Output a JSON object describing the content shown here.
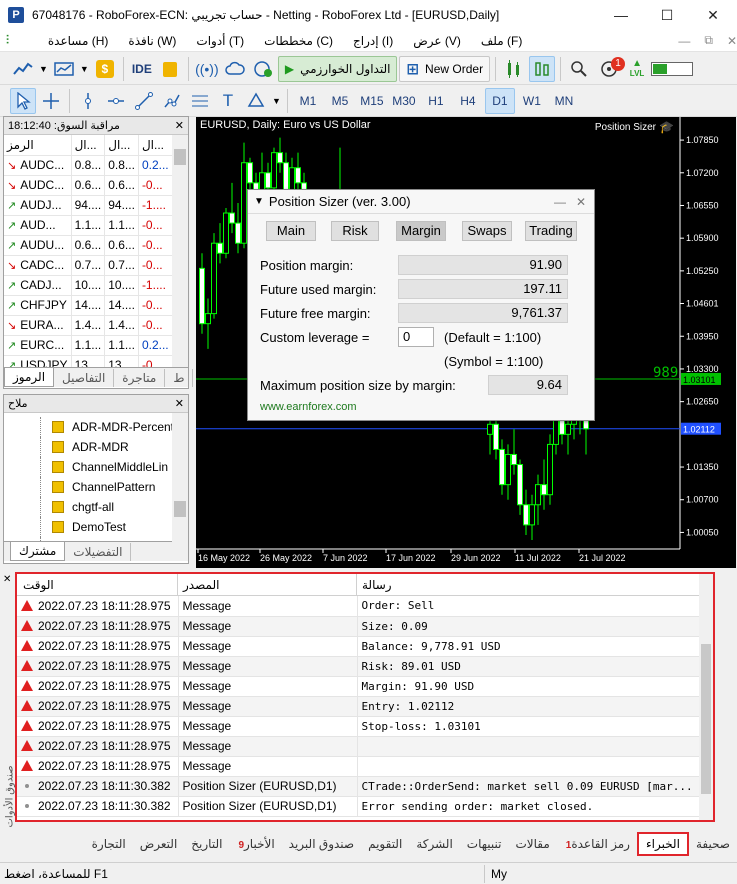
{
  "window": {
    "title": "67048176 - RoboForex-ECN: حساب تجريبي - Netting - RoboForex Ltd - [EURUSD,Daily]",
    "app_icon_letter": "P",
    "minimize": "—",
    "maximize": "☐",
    "close": "✕"
  },
  "menu": {
    "items": [
      "ملف (F)",
      "عرض (V)",
      "إدراج (I)",
      "مخططات (C)",
      "أدوات (T)",
      "نافذة (W)",
      "مساعدة (H)"
    ],
    "restore": "⧉",
    "close": "✕"
  },
  "toolbar1": {
    "ide": "IDE",
    "algo_trading": "التداول الخوارزمي",
    "new_order": "New Order",
    "notifications_count": "1",
    "lvl_label": "LVL"
  },
  "toolbar2": {
    "timeframes": [
      "M1",
      "M5",
      "M15",
      "M30",
      "H1",
      "H4",
      "D1",
      "W1",
      "MN"
    ],
    "selected_timeframe": "D1"
  },
  "market_watch": {
    "title": "مراقبة السوق: 18:12:40",
    "columns": [
      "الرمز",
      "ال...",
      "ال...",
      "ال..."
    ],
    "rows": [
      {
        "dir": "down",
        "symbol": "AUDC...",
        "bid": "0.8...",
        "ask": "0.8...",
        "chg": "0.2...",
        "chg_sign": "pos"
      },
      {
        "dir": "down",
        "symbol": "AUDC...",
        "bid": "0.6...",
        "ask": "0.6...",
        "chg": "-0...",
        "chg_sign": "neg"
      },
      {
        "dir": "up",
        "symbol": "AUDJ...",
        "bid": "94....",
        "ask": "94....",
        "chg": "-1....",
        "chg_sign": "neg"
      },
      {
        "dir": "up",
        "symbol": "AUD...",
        "bid": "1.1...",
        "ask": "1.1...",
        "chg": "-0...",
        "chg_sign": "neg"
      },
      {
        "dir": "up",
        "symbol": "AUDU...",
        "bid": "0.6...",
        "ask": "0.6...",
        "chg": "-0...",
        "chg_sign": "neg"
      },
      {
        "dir": "down",
        "symbol": "CADC...",
        "bid": "0.7...",
        "ask": "0.7...",
        "chg": "-0...",
        "chg_sign": "neg"
      },
      {
        "dir": "up",
        "symbol": "CADJ...",
        "bid": "10....",
        "ask": "10....",
        "chg": "-1....",
        "chg_sign": "neg"
      },
      {
        "dir": "up",
        "symbol": "CHFJPY",
        "bid": "14....",
        "ask": "14....",
        "chg": "-0...",
        "chg_sign": "neg"
      },
      {
        "dir": "down",
        "symbol": "EURA...",
        "bid": "1.4...",
        "ask": "1.4...",
        "chg": "-0...",
        "chg_sign": "neg"
      },
      {
        "dir": "up",
        "symbol": "EURC...",
        "bid": "1.1...",
        "ask": "1.1...",
        "chg": "0.2...",
        "chg_sign": "pos"
      },
      {
        "dir": "up",
        "symbol": "USDJPY",
        "bid": "13...",
        "ask": "13...",
        "chg": "-0...",
        "chg_sign": "neg"
      }
    ],
    "tabs": [
      "الرموز",
      "التفاصيل",
      "متاجرة",
      "ط"
    ]
  },
  "navigator": {
    "title": "ملاح",
    "items": [
      "ADR-MDR-Percent",
      "ADR-MDR",
      "ChannelMiddleLin",
      "ChannelPattern",
      "chgtf-all",
      "DemoTest",
      "DrawLines"
    ],
    "tabs": [
      "مشترك",
      "التفضيلات"
    ]
  },
  "chart": {
    "title": "EURUSD, Daily:  Euro vs US Dollar",
    "indicator_label": "Position Sizer",
    "price_labels": [
      "1.07850",
      "1.07200",
      "1.06550",
      "1.05900",
      "1.05250",
      "1.04601",
      "1.03950",
      "1.03300",
      "1.03101",
      "1.02650",
      "1.02112",
      "1.01350",
      "1.00700",
      "1.00050"
    ],
    "date_labels": [
      "16 May 2022",
      "26 May 2022",
      "7 Jun 2022",
      "17 Jun 2022",
      "29 Jun 2022",
      "11 Jul 2022",
      "21 Jul 2022"
    ],
    "stop_pips": "989",
    "sl_price": "1.03101",
    "entry_price": "1.02112"
  },
  "position_sizer": {
    "title": "Position Sizer (ver. 3.00)",
    "tabs": [
      "Main",
      "Risk",
      "Margin",
      "Swaps",
      "Trading"
    ],
    "active_tab": "Margin",
    "position_margin_label": "Position margin:",
    "position_margin": "91.90",
    "future_used_margin_label": "Future used margin:",
    "future_used_margin": "197.11",
    "future_free_margin_label": "Future free margin:",
    "future_free_margin": "9,761.37",
    "custom_leverage_label": "Custom leverage =",
    "custom_leverage": "0",
    "default_leverage": "(Default = 1:100)",
    "symbol_leverage": "(Symbol = 1:100)",
    "max_size_label": "Maximum position size by margin:",
    "max_size": "9.64",
    "footer_link": "www.earnforex.com"
  },
  "journal": {
    "columns": [
      "الوقت",
      "المصدر",
      "رسالة"
    ],
    "rows": [
      {
        "icon": "warning",
        "time": "2022.07.23 18:11:28.975",
        "source": "Message",
        "message": "Order: Sell"
      },
      {
        "icon": "warning",
        "time": "2022.07.23 18:11:28.975",
        "source": "Message",
        "message": "Size: 0.09"
      },
      {
        "icon": "warning",
        "time": "2022.07.23 18:11:28.975",
        "source": "Message",
        "message": "Balance: 9,778.91 USD"
      },
      {
        "icon": "warning",
        "time": "2022.07.23 18:11:28.975",
        "source": "Message",
        "message": "Risk: 89.01 USD"
      },
      {
        "icon": "warning",
        "time": "2022.07.23 18:11:28.975",
        "source": "Message",
        "message": "Margin: 91.90 USD"
      },
      {
        "icon": "warning",
        "time": "2022.07.23 18:11:28.975",
        "source": "Message",
        "message": "Entry: 1.02112"
      },
      {
        "icon": "warning",
        "time": "2022.07.23 18:11:28.975",
        "source": "Message",
        "message": "Stop-loss: 1.03101"
      },
      {
        "icon": "warning",
        "time": "2022.07.23 18:11:28.975",
        "source": "Message",
        "message": ""
      },
      {
        "icon": "warning",
        "time": "2022.07.23 18:11:28.975",
        "source": "Message",
        "message": ""
      },
      {
        "icon": "info",
        "time": "2022.07.23 18:11:30.382",
        "source": "Position Sizer (EURUSD,D1)",
        "message": "CTrade::OrderSend: market sell 0.09 EURUSD [mar..."
      },
      {
        "icon": "info",
        "time": "2022.07.23 18:11:30.382",
        "source": "Position Sizer (EURUSD,D1)",
        "message": "Error sending order: market closed."
      }
    ],
    "side_label": "صندوق الأدوات"
  },
  "bottom_tabs": [
    {
      "label": "صحيفة",
      "badge": ""
    },
    {
      "label": "الخبراء",
      "badge": "",
      "active": true
    },
    {
      "label": "رمز القاعدة",
      "badge": "1"
    },
    {
      "label": "مقالات",
      "badge": ""
    },
    {
      "label": "تنبيهات",
      "badge": ""
    },
    {
      "label": "الشركة",
      "badge": ""
    },
    {
      "label": "التقويم",
      "badge": ""
    },
    {
      "label": "صندوق البريد",
      "badge": ""
    },
    {
      "label": "الأخبار",
      "badge": "9"
    },
    {
      "label": "التاريخ",
      "badge": ""
    },
    {
      "label": "التعرض",
      "badge": ""
    },
    {
      "label": "التجارة",
      "badge": ""
    }
  ],
  "status": {
    "help": "للمساعدة، اضغط F1",
    "profile": "My"
  }
}
